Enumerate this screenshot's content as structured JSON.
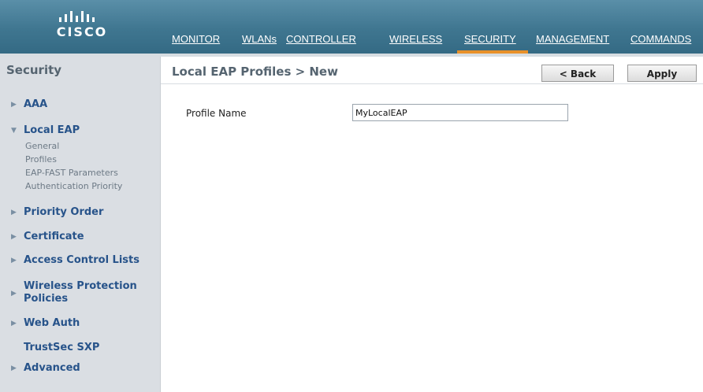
{
  "brand": {
    "logo_text": "CISCO"
  },
  "nav": {
    "items": [
      {
        "label": "MONITOR"
      },
      {
        "label": "WLANs"
      },
      {
        "label": "CONTROLLER"
      },
      {
        "label": "WIRELESS"
      },
      {
        "label": "SECURITY",
        "active": true
      },
      {
        "label": "MANAGEMENT"
      },
      {
        "label": "COMMANDS"
      }
    ]
  },
  "sidebar": {
    "title": "Security",
    "items": [
      {
        "label": "AAA",
        "arrow": "right"
      },
      {
        "label": "Local EAP",
        "arrow": "down",
        "children": [
          "General",
          "Profiles",
          "EAP-FAST Parameters",
          "Authentication Priority"
        ]
      },
      {
        "label": "Priority Order",
        "arrow": "right"
      },
      {
        "label": "Certificate",
        "arrow": "right"
      },
      {
        "label": "Access Control Lists",
        "arrow": "right"
      },
      {
        "label": "Wireless Protection Policies",
        "arrow": "right"
      },
      {
        "label": "Web Auth",
        "arrow": "right"
      },
      {
        "label": "TrustSec SXP",
        "arrow": "none"
      },
      {
        "label": "Advanced",
        "arrow": "right"
      }
    ]
  },
  "main": {
    "title": "Local EAP Profiles > New",
    "back_label": "< Back",
    "apply_label": "Apply",
    "form": {
      "profile_name_label": "Profile Name",
      "profile_name_value": "MyLocalEAP"
    }
  },
  "colors": {
    "header": "#3f7690",
    "active_tab": "#e8912a",
    "sidebar_bg": "#dadee3",
    "sidebar_link": "#27538a"
  }
}
